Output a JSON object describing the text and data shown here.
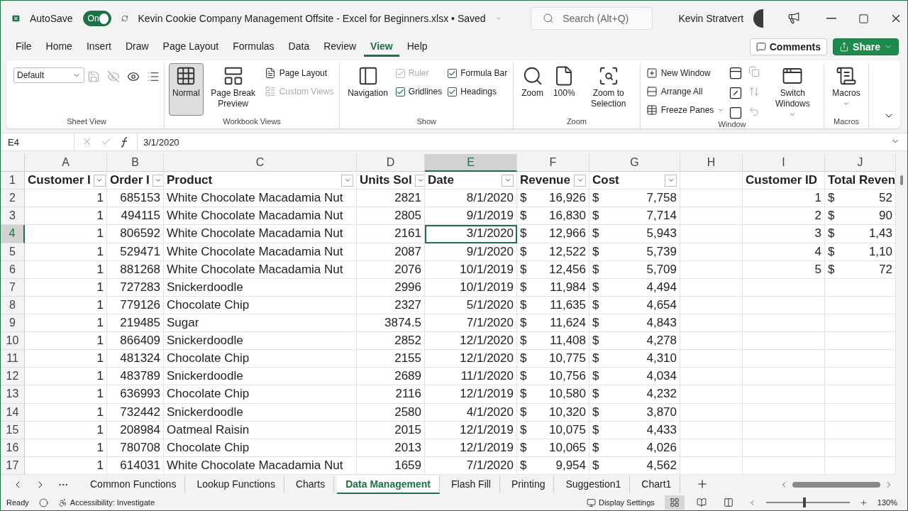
{
  "title_bar": {
    "autosave": {
      "label": "AutoSave",
      "state_label": "On",
      "on": true
    },
    "document_title": "Kevin Cookie Company Management Offsite - Excel for Beginners.xlsx • Saved",
    "search": {
      "placeholder": "Search (Alt+Q)"
    },
    "user_name": "Kevin Stratvert"
  },
  "menu_tabs": [
    {
      "label": "File",
      "selected": false
    },
    {
      "label": "Home",
      "selected": false
    },
    {
      "label": "Insert",
      "selected": false
    },
    {
      "label": "Draw",
      "selected": false
    },
    {
      "label": "Page Layout",
      "selected": false
    },
    {
      "label": "Formulas",
      "selected": false
    },
    {
      "label": "Data",
      "selected": false
    },
    {
      "label": "Review",
      "selected": false
    },
    {
      "label": "View",
      "selected": true
    },
    {
      "label": "Help",
      "selected": false
    }
  ],
  "comments_button": "Comments",
  "share_button": "Share",
  "ribbon": [
    {
      "label": "Sheet View",
      "items": [
        {
          "kind": "select",
          "label": "Default"
        },
        {
          "kind": "toolbar"
        }
      ]
    },
    {
      "label": "Workbook Views",
      "items": [
        {
          "kind": "large",
          "label": "Normal",
          "selected": true
        },
        {
          "kind": "large",
          "label": "Page Break Preview",
          "selected": false
        },
        {
          "kind": "stack",
          "children": [
            {
              "kind": "small",
              "label": "Page Layout",
              "disabled": false
            },
            {
              "kind": "small",
              "label": "Custom Views",
              "disabled": true
            }
          ]
        }
      ]
    },
    {
      "label": "Show",
      "items": [
        {
          "kind": "large",
          "label": "Navigation",
          "selected": false
        },
        {
          "kind": "stack",
          "children": [
            {
              "kind": "check",
              "label": "Ruler",
              "checked": true,
              "disabled": true
            },
            {
              "kind": "check",
              "label": "Gridlines",
              "checked": true,
              "disabled": false
            }
          ]
        },
        {
          "kind": "stack",
          "children": [
            {
              "kind": "check",
              "label": "Formula Bar",
              "checked": true,
              "disabled": false
            },
            {
              "kind": "check",
              "label": "Headings",
              "checked": true,
              "disabled": false
            }
          ]
        }
      ]
    },
    {
      "label": "Zoom",
      "items": [
        {
          "kind": "large",
          "label": "Zoom",
          "selected": false
        },
        {
          "kind": "large",
          "label": "100%",
          "selected": false
        },
        {
          "kind": "large",
          "label": "Zoom to Selection",
          "selected": false
        }
      ]
    },
    {
      "label": "Window",
      "items": [
        {
          "kind": "stack",
          "children": [
            {
              "kind": "small",
              "label": "New Window",
              "disabled": false
            },
            {
              "kind": "small",
              "label": "Arrange All",
              "disabled": false
            },
            {
              "kind": "small",
              "label": "Freeze Panes",
              "disabled": false,
              "caret": true
            }
          ]
        },
        {
          "kind": "icongrid"
        },
        {
          "kind": "large",
          "label": "Switch Windows",
          "selected": false,
          "caret": true
        }
      ]
    },
    {
      "label": "Macros",
      "items": [
        {
          "kind": "large",
          "label": "Macros",
          "selected": false,
          "caret": true
        }
      ]
    }
  ],
  "formula_bar": {
    "name_box": "E4",
    "formula": "3/1/2020"
  },
  "sheet": {
    "columns": [
      {
        "letter": "A",
        "selected": false
      },
      {
        "letter": "B",
        "selected": false
      },
      {
        "letter": "C",
        "selected": false
      },
      {
        "letter": "D",
        "selected": false
      },
      {
        "letter": "E",
        "selected": true
      },
      {
        "letter": "F",
        "selected": false
      },
      {
        "letter": "G",
        "selected": false
      },
      {
        "letter": "H",
        "selected": false
      },
      {
        "letter": "I",
        "selected": false
      },
      {
        "letter": "J",
        "selected": false
      }
    ],
    "header_row": {
      "number": "1",
      "selected": false,
      "table": [
        {
          "label": "Customer I",
          "filter": true
        },
        {
          "label": "Order I",
          "filter": true
        },
        {
          "label": "Product",
          "filter": true
        },
        {
          "label": "Units Sol",
          "filter": true
        },
        {
          "label": "Date",
          "filter": true
        },
        {
          "label": "Revenue",
          "filter": true
        },
        {
          "label": "Cost",
          "filter": true
        }
      ],
      "side": [
        "Customer ID",
        "Total Reven"
      ]
    },
    "rows": [
      {
        "number": "2",
        "selected": false,
        "table": [
          "1",
          "685153",
          "White Chocolate Macadamia Nut",
          "2821",
          "8/1/2020",
          "$",
          "16,926",
          "$",
          "7,758"
        ],
        "side": [
          "1",
          "$",
          "52"
        ]
      },
      {
        "number": "3",
        "selected": false,
        "table": [
          "1",
          "494115",
          "White Chocolate Macadamia Nut",
          "2805",
          "9/1/2019",
          "$",
          "16,830",
          "$",
          "7,714"
        ],
        "side": [
          "2",
          "$",
          "90"
        ]
      },
      {
        "number": "4",
        "selected": true,
        "table": [
          "1",
          "806592",
          "White Chocolate Macadamia Nut",
          "2161",
          "3/1/2020",
          "$",
          "12,966",
          "$",
          "5,943"
        ],
        "side": [
          "3",
          "$",
          "1,43"
        ]
      },
      {
        "number": "5",
        "selected": false,
        "table": [
          "1",
          "529471",
          "White Chocolate Macadamia Nut",
          "2087",
          "9/1/2020",
          "$",
          "12,522",
          "$",
          "5,739"
        ],
        "side": [
          "4",
          "$",
          "1,10"
        ]
      },
      {
        "number": "6",
        "selected": false,
        "table": [
          "1",
          "881268",
          "White Chocolate Macadamia Nut",
          "2076",
          "10/1/2019",
          "$",
          "12,456",
          "$",
          "5,709"
        ],
        "side": [
          "5",
          "$",
          "72"
        ]
      },
      {
        "number": "7",
        "selected": false,
        "table": [
          "1",
          "727283",
          "Snickerdoodle",
          "2996",
          "10/1/2019",
          "$",
          "11,984",
          "$",
          "4,494"
        ]
      },
      {
        "number": "8",
        "selected": false,
        "table": [
          "1",
          "779126",
          "Chocolate Chip",
          "2327",
          "5/1/2020",
          "$",
          "11,635",
          "$",
          "4,654"
        ]
      },
      {
        "number": "9",
        "selected": false,
        "table": [
          "1",
          "219485",
          "Sugar",
          "3874.5",
          "7/1/2020",
          "$",
          "11,624",
          "$",
          "4,843"
        ]
      },
      {
        "number": "10",
        "selected": false,
        "table": [
          "1",
          "866409",
          "Snickerdoodle",
          "2852",
          "12/1/2020",
          "$",
          "11,408",
          "$",
          "4,278"
        ]
      },
      {
        "number": "11",
        "selected": false,
        "table": [
          "1",
          "481324",
          "Chocolate Chip",
          "2155",
          "12/1/2020",
          "$",
          "10,775",
          "$",
          "4,310"
        ]
      },
      {
        "number": "12",
        "selected": false,
        "table": [
          "1",
          "483789",
          "Snickerdoodle",
          "2689",
          "11/1/2020",
          "$",
          "10,756",
          "$",
          "4,034"
        ]
      },
      {
        "number": "13",
        "selected": false,
        "table": [
          "1",
          "636993",
          "Chocolate Chip",
          "2116",
          "12/1/2019",
          "$",
          "10,580",
          "$",
          "4,232"
        ]
      },
      {
        "number": "14",
        "selected": false,
        "table": [
          "1",
          "732442",
          "Snickerdoodle",
          "2580",
          "4/1/2020",
          "$",
          "10,320",
          "$",
          "3,870"
        ]
      },
      {
        "number": "15",
        "selected": false,
        "table": [
          "1",
          "208984",
          "Oatmeal Raisin",
          "2015",
          "12/1/2019",
          "$",
          "10,075",
          "$",
          "4,433"
        ]
      },
      {
        "number": "16",
        "selected": false,
        "table": [
          "1",
          "780708",
          "Chocolate Chip",
          "2013",
          "12/1/2019",
          "$",
          "10,065",
          "$",
          "4,026"
        ]
      },
      {
        "number": "17",
        "selected": false,
        "table": [
          "1",
          "614031",
          "White Chocolate Macadamia Nut",
          "1659",
          "7/1/2020",
          "$",
          "9,954",
          "$",
          "4,562"
        ]
      }
    ]
  },
  "sheet_tabs": [
    {
      "label": "Common Functions",
      "selected": false
    },
    {
      "label": "Lookup Functions",
      "selected": false
    },
    {
      "label": "Charts",
      "selected": false
    },
    {
      "label": "Data Management",
      "selected": true
    },
    {
      "label": "Flash Fill",
      "selected": false
    },
    {
      "label": "Printing",
      "selected": false
    },
    {
      "label": "Suggestion1",
      "selected": false
    },
    {
      "label": "Chart1",
      "selected": false
    }
  ],
  "status_bar": {
    "mode": "Ready",
    "accessibility": "Accessibility: Investigate",
    "display_settings": "Display Settings",
    "views": [
      {
        "selected": true
      },
      {
        "selected": false
      },
      {
        "selected": false
      }
    ],
    "zoom": {
      "level": 0.46,
      "label": "130%"
    }
  }
}
